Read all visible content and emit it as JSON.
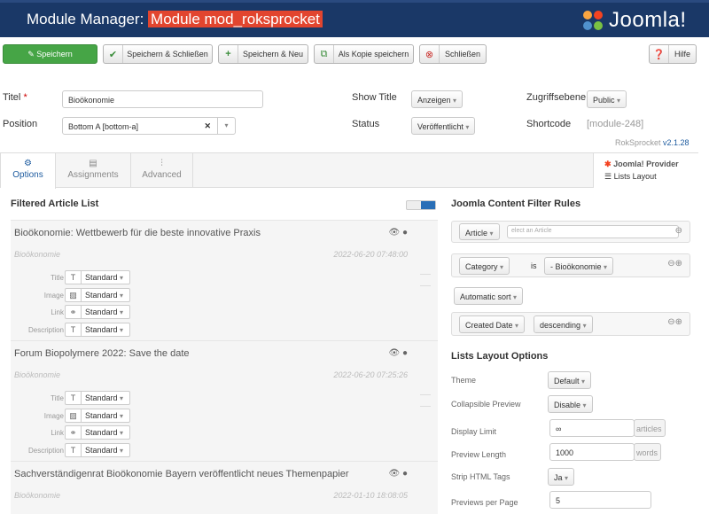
{
  "header": {
    "title_prefix": "Module Manager: ",
    "title_highlight": "Module mod_roksprocket",
    "logo_text": "Joomla!"
  },
  "toolbar": {
    "save": "Speichern",
    "save_close": "Speichern & Schließen",
    "save_new": "Speichern & Neu",
    "save_copy": "Als Kopie speichern",
    "close": "Schließen",
    "help": "Hilfe"
  },
  "form": {
    "title_label": "Titel",
    "title_value": "Bioökonomie",
    "position_label": "Position",
    "position_value": "Bottom A [bottom-a]",
    "show_title_label": "Show Title",
    "show_title_value": "Anzeigen",
    "status_label": "Status",
    "status_value": "Veröffentlicht",
    "access_label": "Zugriffsebene",
    "access_value": "Public",
    "shortcode_label": "Shortcode",
    "shortcode_value": "[module-248]",
    "version_prefix": "RokSprocket ",
    "version": "v2.1.28"
  },
  "tabs": {
    "options": "Options",
    "assignments": "Assignments",
    "advanced": "Advanced",
    "provider": "Joomla! Provider",
    "layout": "Lists Layout"
  },
  "filtered": {
    "heading": "Filtered Article List"
  },
  "articles": [
    {
      "title": "Bioökonomie: Wettbewerb für die beste innovative Praxis",
      "category": "Bioökonomie",
      "date": "2022-06-20 07:48:00"
    },
    {
      "title": "Forum Biopolymere 2022: Save the date",
      "category": "Bioökonomie",
      "date": "2022-06-20 07:25:26"
    },
    {
      "title": "Sachverständigenrat Bioökonomie Bayern veröffentlicht neues Themenpapier",
      "category": "Bioökonomie",
      "date": "2022-01-10 18:08:05"
    }
  ],
  "fields": {
    "title": "Title",
    "image": "Image",
    "link": "Link",
    "description": "Description",
    "standard": "Standard"
  },
  "filter_rules": {
    "heading": "Joomla Content Filter Rules",
    "article": "Article",
    "article_placeholder": "elect an Article",
    "category": "Category",
    "is": "is",
    "category_value": "- Bioökonomie",
    "auto_sort": "Automatic sort",
    "created_date": "Created Date",
    "descending": "descending"
  },
  "layout_options": {
    "heading": "Lists Layout Options",
    "theme_label": "Theme",
    "theme_value": "Default",
    "collapsible_label": "Collapsible Preview",
    "collapsible_value": "Disable",
    "display_limit_label": "Display Limit",
    "display_limit_value": "∞",
    "display_limit_unit": "articles",
    "preview_length_label": "Preview Length",
    "preview_length_value": "1000",
    "preview_length_unit": "words",
    "strip_html_label": "Strip HTML Tags",
    "strip_html_value": "Ja",
    "per_page_label": "Previews per Page",
    "per_page_value": "5"
  },
  "icons": {
    "save": "pencil-icon",
    "check": "check-icon",
    "plus": "plus-icon",
    "copy": "copy-icon",
    "close": "close-circle-icon",
    "help": "question-icon"
  }
}
